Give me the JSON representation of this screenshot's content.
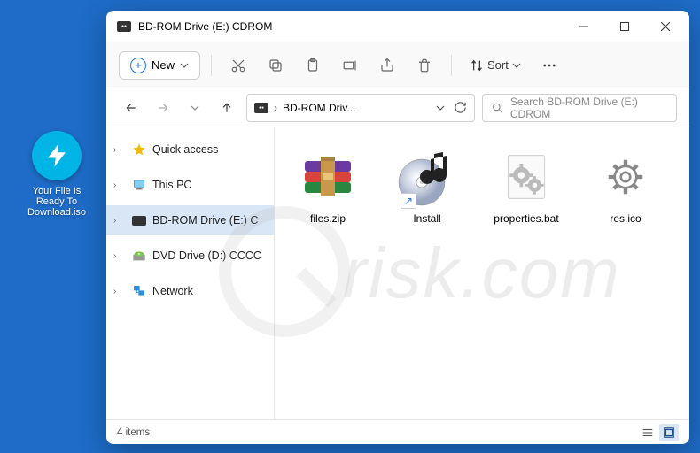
{
  "desktop": {
    "icon_label": "Your File Is Ready To Download.iso"
  },
  "window": {
    "title": "BD-ROM Drive (E:) CDROM"
  },
  "toolbar": {
    "new_label": "New",
    "sort_label": "Sort"
  },
  "breadcrumb": {
    "path": "BD-ROM Driv..."
  },
  "search": {
    "placeholder": "Search BD-ROM Drive (E:) CDROM"
  },
  "sidebar": {
    "items": [
      {
        "label": "Quick access"
      },
      {
        "label": "This PC"
      },
      {
        "label": "BD-ROM Drive (E:) C"
      },
      {
        "label": "DVD Drive (D:) CCCC"
      },
      {
        "label": "Network"
      }
    ]
  },
  "files": [
    {
      "label": "files.zip"
    },
    {
      "label": "Install"
    },
    {
      "label": "properties.bat"
    },
    {
      "label": "res.ico"
    }
  ],
  "statusbar": {
    "count_label": "4 items"
  },
  "watermark": "risk.com"
}
